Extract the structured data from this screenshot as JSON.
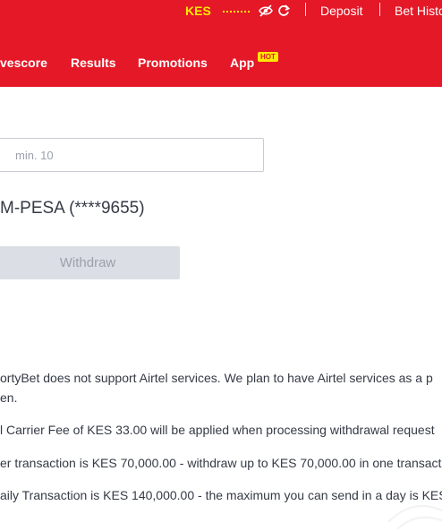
{
  "header": {
    "currency": "KES",
    "icons": {
      "balance_visibility": "eye-slash-icon",
      "refresh": "refresh-icon"
    },
    "links": {
      "deposit": "Deposit",
      "bet_history": "Bet Histo"
    },
    "nav": [
      {
        "label": "vescore"
      },
      {
        "label": "Results"
      },
      {
        "label": "Promotions"
      },
      {
        "label": "App"
      }
    ],
    "hot_badge": "HOT",
    "colors": {
      "brand_red": "#e41827",
      "accent_yellow": "#ffe800"
    }
  },
  "form": {
    "amount_placeholder": "min. 10",
    "account": "M-PESA (****9655)",
    "withdraw_label": "Withdraw"
  },
  "notes": [
    "ortyBet does not support Airtel services. We plan to have Airtel services as a p",
    "en.",
    "l Carrier Fee of KES 33.00 will be applied when processing withdrawal request",
    "er transaction is KES 70,000.00 - withdraw up to KES 70,000.00 in one transacti",
    "aily Transaction is KES 140,000.00 - the maximum you can send in a day is KES"
  ]
}
